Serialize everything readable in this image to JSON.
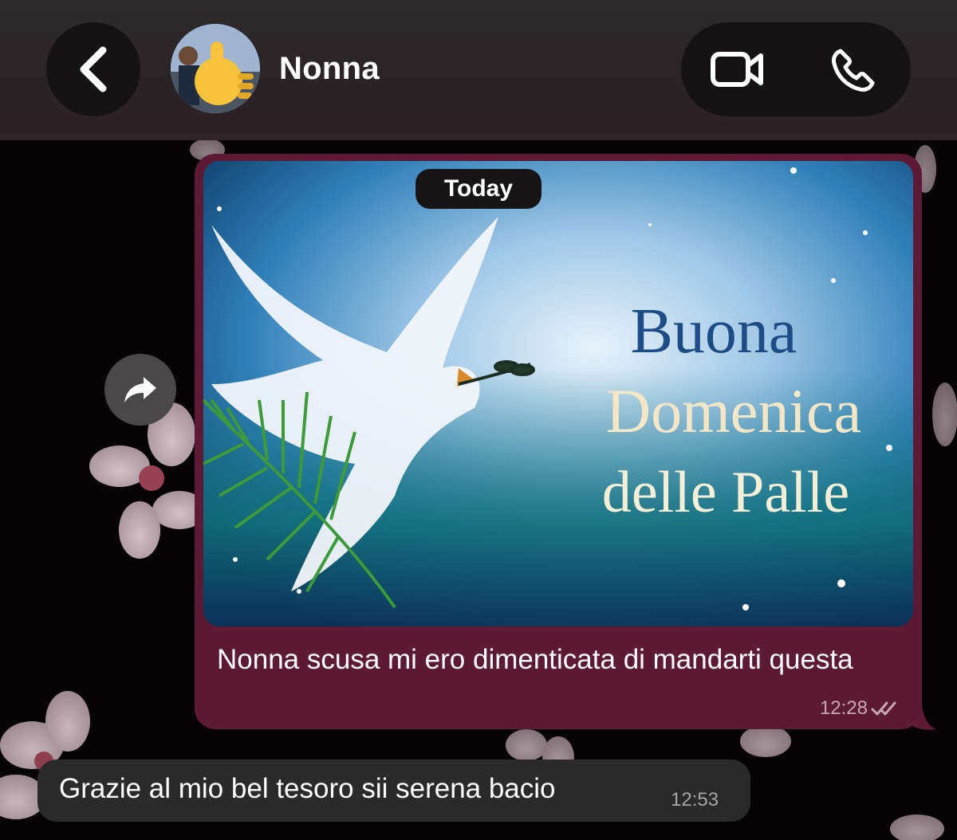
{
  "header": {
    "contact_name": "Nonna",
    "back_icon": "chevron-left-icon",
    "video_icon": "video-camera-icon",
    "call_icon": "phone-icon"
  },
  "date_separator": "Today",
  "messages": [
    {
      "direction": "outgoing",
      "media_text": [
        "Buona",
        "Domenica",
        "delle Palle"
      ],
      "caption": "Nonna scusa mi ero dimenticata di mandarti questa",
      "time": "12:28",
      "status": "read-double-check-icon"
    },
    {
      "direction": "incoming",
      "text": "Grazie al mio bel tesoro sii serena bacio",
      "time": "12:53"
    }
  ],
  "colors": {
    "outgoing_bubble": "#5c1a35",
    "incoming_bubble": "#2b2a2b",
    "header_bg": "#2e2a2b"
  }
}
